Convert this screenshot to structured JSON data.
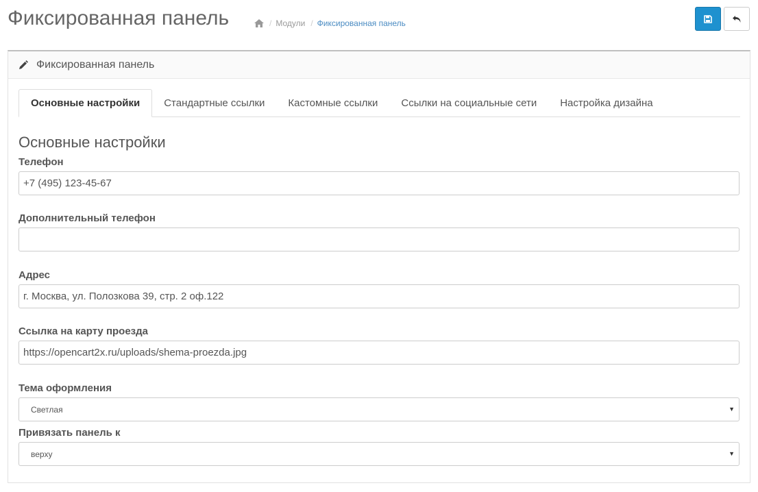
{
  "header": {
    "title": "Фиксированная панель",
    "breadcrumb": [
      {
        "label": "Модули"
      },
      {
        "label": "Фиксированная панель"
      }
    ]
  },
  "toolbar": {
    "save_icon": "floppy-disk-icon",
    "back_icon": "reply-arrow-icon",
    "save_color": "#1e91cf"
  },
  "panel": {
    "title": "Фиксированная панель",
    "tabs": [
      {
        "label": "Основные настройки",
        "active": true
      },
      {
        "label": "Стандартные ссылки"
      },
      {
        "label": "Кастомные ссылки"
      },
      {
        "label": "Ссылки на социальные сети"
      },
      {
        "label": "Настройка дизайна"
      }
    ]
  },
  "form": {
    "section_title": "Основные настройки",
    "phone": {
      "label": "Телефон",
      "value": "+7 (495) 123-45-67"
    },
    "extra_phone": {
      "label": "Дополнительный телефон",
      "value": ""
    },
    "address": {
      "label": "Адрес",
      "value": "г. Москва, ул. Полозкова 39, стр. 2 оф.122"
    },
    "map_link": {
      "label": "Ссылка на карту проезда",
      "value": "https://opencart2x.ru/uploads/shema-proezda.jpg"
    },
    "theme": {
      "label": "Тема оформления",
      "selected": "Светлая"
    },
    "attach": {
      "label": "Привязать панель к",
      "selected": "верху"
    }
  }
}
